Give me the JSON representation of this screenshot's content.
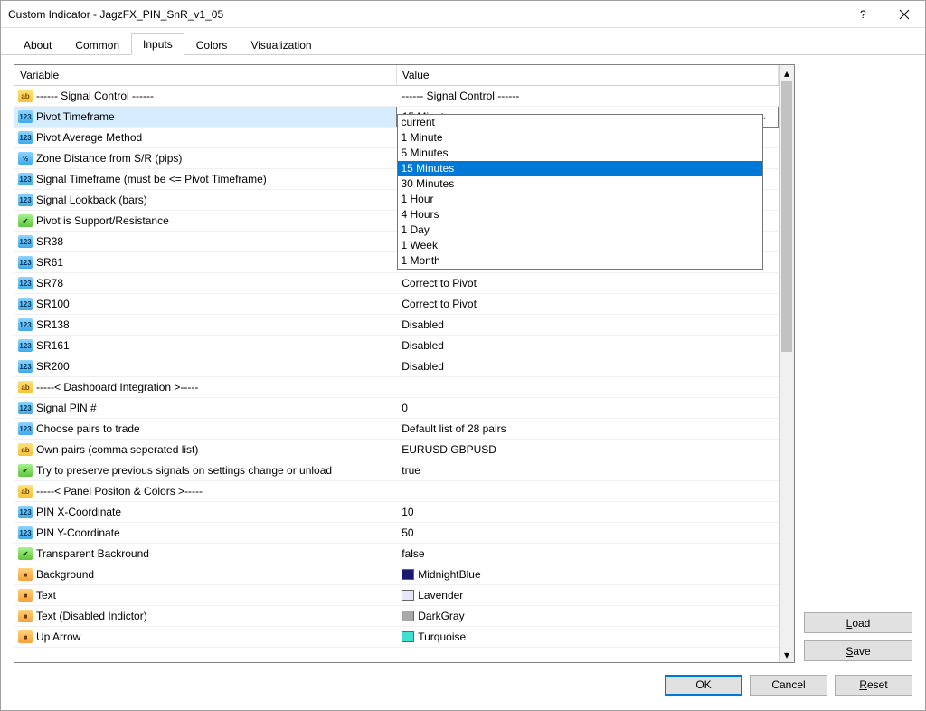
{
  "window": {
    "title": "Custom Indicator - JagzFX_PIN_SnR_v1_05"
  },
  "tabs": [
    "About",
    "Common",
    "Inputs",
    "Colors",
    "Visualization"
  ],
  "active_tab": 2,
  "columns": {
    "variable": "Variable",
    "value": "Value"
  },
  "rows": [
    {
      "icon": "ab",
      "name": "------ Signal Control  ------",
      "value": "------ Signal Control  ------"
    },
    {
      "icon": "n123",
      "name": "Pivot Timeframe",
      "value": "15 Minutes",
      "selected": true,
      "dropdown": true
    },
    {
      "icon": "n123",
      "name": "Pivot Average Method",
      "value": ""
    },
    {
      "icon": "half",
      "name": "Zone Distance from S/R (pips)",
      "value": ""
    },
    {
      "icon": "n123",
      "name": "Signal Timeframe (must be <= Pivot Timeframe)",
      "value": ""
    },
    {
      "icon": "n123",
      "name": "Signal Lookback (bars)",
      "value": ""
    },
    {
      "icon": "bool",
      "name": "Pivot is Support/Resistance",
      "value": ""
    },
    {
      "icon": "n123",
      "name": "SR38",
      "value": ""
    },
    {
      "icon": "n123",
      "name": "SR61",
      "value": ""
    },
    {
      "icon": "n123",
      "name": "SR78",
      "value": "Correct to Pivot"
    },
    {
      "icon": "n123",
      "name": "SR100",
      "value": "Correct to Pivot"
    },
    {
      "icon": "n123",
      "name": "SR138",
      "value": "Disabled"
    },
    {
      "icon": "n123",
      "name": "SR161",
      "value": "Disabled"
    },
    {
      "icon": "n123",
      "name": "SR200",
      "value": "Disabled"
    },
    {
      "icon": "ab",
      "name": "-----< Dashboard Integration >-----",
      "value": ""
    },
    {
      "icon": "n123",
      "name": "Signal PIN #",
      "value": "0"
    },
    {
      "icon": "n123",
      "name": "Choose pairs to trade",
      "value": "Default list of 28 pairs"
    },
    {
      "icon": "ab",
      "name": "Own pairs (comma seperated list)",
      "value": "EURUSD,GBPUSD"
    },
    {
      "icon": "bool",
      "name": "Try to preserve previous signals on settings change or unload",
      "value": "true"
    },
    {
      "icon": "ab",
      "name": "-----< Panel Positon & Colors >-----",
      "value": ""
    },
    {
      "icon": "n123",
      "name": "PIN X-Coordinate",
      "value": "10"
    },
    {
      "icon": "n123",
      "name": "PIN Y-Coordinate",
      "value": "50"
    },
    {
      "icon": "bool",
      "name": "Transparent Backround",
      "value": "false"
    },
    {
      "icon": "color",
      "name": "Background",
      "value": "MidnightBlue",
      "swatch": "#191970"
    },
    {
      "icon": "color",
      "name": "Text",
      "value": "Lavender",
      "swatch": "#e6e6fa"
    },
    {
      "icon": "color",
      "name": "Text (Disabled Indictor)",
      "value": "DarkGray",
      "swatch": "#a9a9a9"
    },
    {
      "icon": "color",
      "name": "Up Arrow",
      "value": "Turquoise",
      "swatch": "#40e0d0"
    }
  ],
  "dropdown_options": [
    "current",
    "1 Minute",
    "5 Minutes",
    "15 Minutes",
    "30 Minutes",
    "1 Hour",
    "4 Hours",
    "1 Day",
    "1 Week",
    "1 Month"
  ],
  "dropdown_selected": "15 Minutes",
  "side_buttons": {
    "load": "Load",
    "save": "Save"
  },
  "footer_buttons": {
    "ok": "OK",
    "cancel": "Cancel",
    "reset": "Reset"
  },
  "icon_labels": {
    "ab": "ab",
    "n123": "123",
    "half": "½",
    "bool": "✔",
    "color": "■"
  }
}
